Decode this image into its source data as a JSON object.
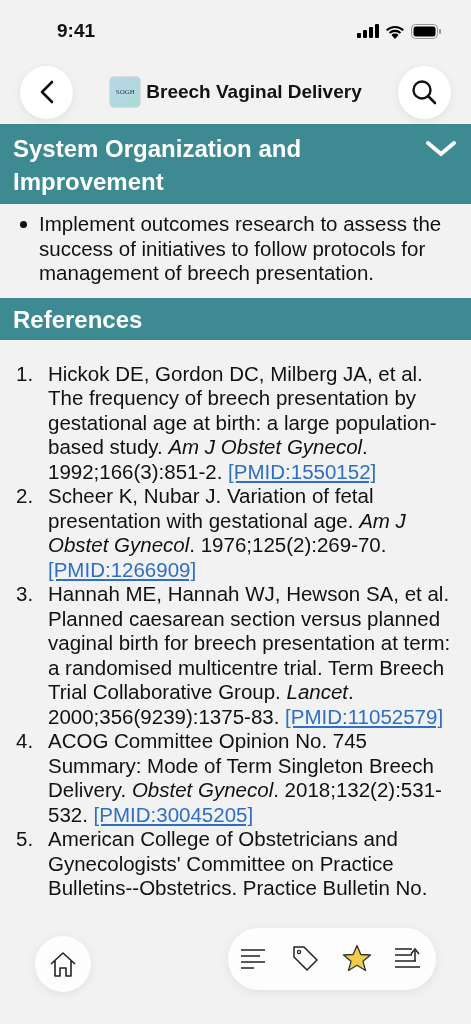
{
  "status_bar": {
    "time": "9:41"
  },
  "nav": {
    "logo": "SOGH",
    "title": "Breech Vaginal Delivery"
  },
  "sections": [
    {
      "title": "System Organization and Improvement",
      "expanded": true,
      "bullets": [
        "Implement outcomes research to assess the success of initiatives to follow protocols for management of breech presentation."
      ]
    },
    {
      "title": "References",
      "references": [
        {
          "number": "1.",
          "text": "Hickok DE, Gordon DC, Milberg JA, et al. The frequency of breech presentation by gestational age at birth: a large population-based study. *Am J Obstet Gynecol*. 1992;166(3):851-2.",
          "link": "[PMID:1550152]"
        },
        {
          "number": "2.",
          "text": "Scheer K, Nubar J. Variation of fetal presentation with gestational age. *Am J Obstet Gynecol*. 1976;125(2):269-70.",
          "link": "[PMID:1266909]"
        },
        {
          "number": "3.",
          "text": "Hannah ME, Hannah WJ, Hewson SA, et al. Planned caesarean section versus planned vaginal birth for breech presentation at term: a randomised multicentre trial. Term Breech Trial Collaborative Group. *Lancet*. 2000;356(9239):1375-83.",
          "link": "[PMID:11052579]"
        },
        {
          "number": "4.",
          "text": "ACOG Committee Opinion No. 745 Summary: Mode of Term Singleton Breech Delivery. *Obstet Gynecol*. 2018;132(2):531-532.",
          "link": "[PMID:30045205]"
        },
        {
          "number": "5.",
          "text": "American College of Obstetricians and Gynecologists' Committee on Practice Bulletins--Obstetrics. Practice Bulletin No."
        }
      ]
    }
  ],
  "toolbar": {
    "favorite": true
  }
}
